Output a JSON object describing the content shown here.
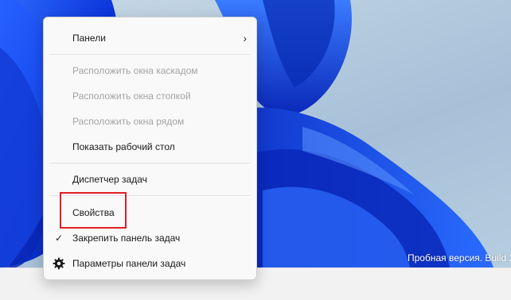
{
  "desktop": {
    "watermark": "Пробная версия. Build 2",
    "accent_colors": [
      "#0a2fd6",
      "#1f5cff",
      "#003aa8"
    ]
  },
  "context_menu": {
    "items": [
      {
        "label": "Панели",
        "enabled": true,
        "submenu": true,
        "icon": "chevron-right-icon"
      },
      {
        "label": "Расположить окна каскадом",
        "enabled": false
      },
      {
        "label": "Расположить окна стопкой",
        "enabled": false
      },
      {
        "label": "Расположить окна рядом",
        "enabled": false
      },
      {
        "label": "Показать рабочий стол",
        "enabled": true
      },
      {
        "label": "Диспетчер задач",
        "enabled": true
      },
      {
        "label": "Свойства",
        "enabled": true,
        "highlighted": true,
        "highlight_color": "#e01f26"
      },
      {
        "label": "Закрепить панель задач",
        "enabled": true,
        "checked": true,
        "icon": "checkmark-icon"
      },
      {
        "label": "Параметры панели задач",
        "enabled": true,
        "icon": "gear-icon"
      }
    ]
  }
}
